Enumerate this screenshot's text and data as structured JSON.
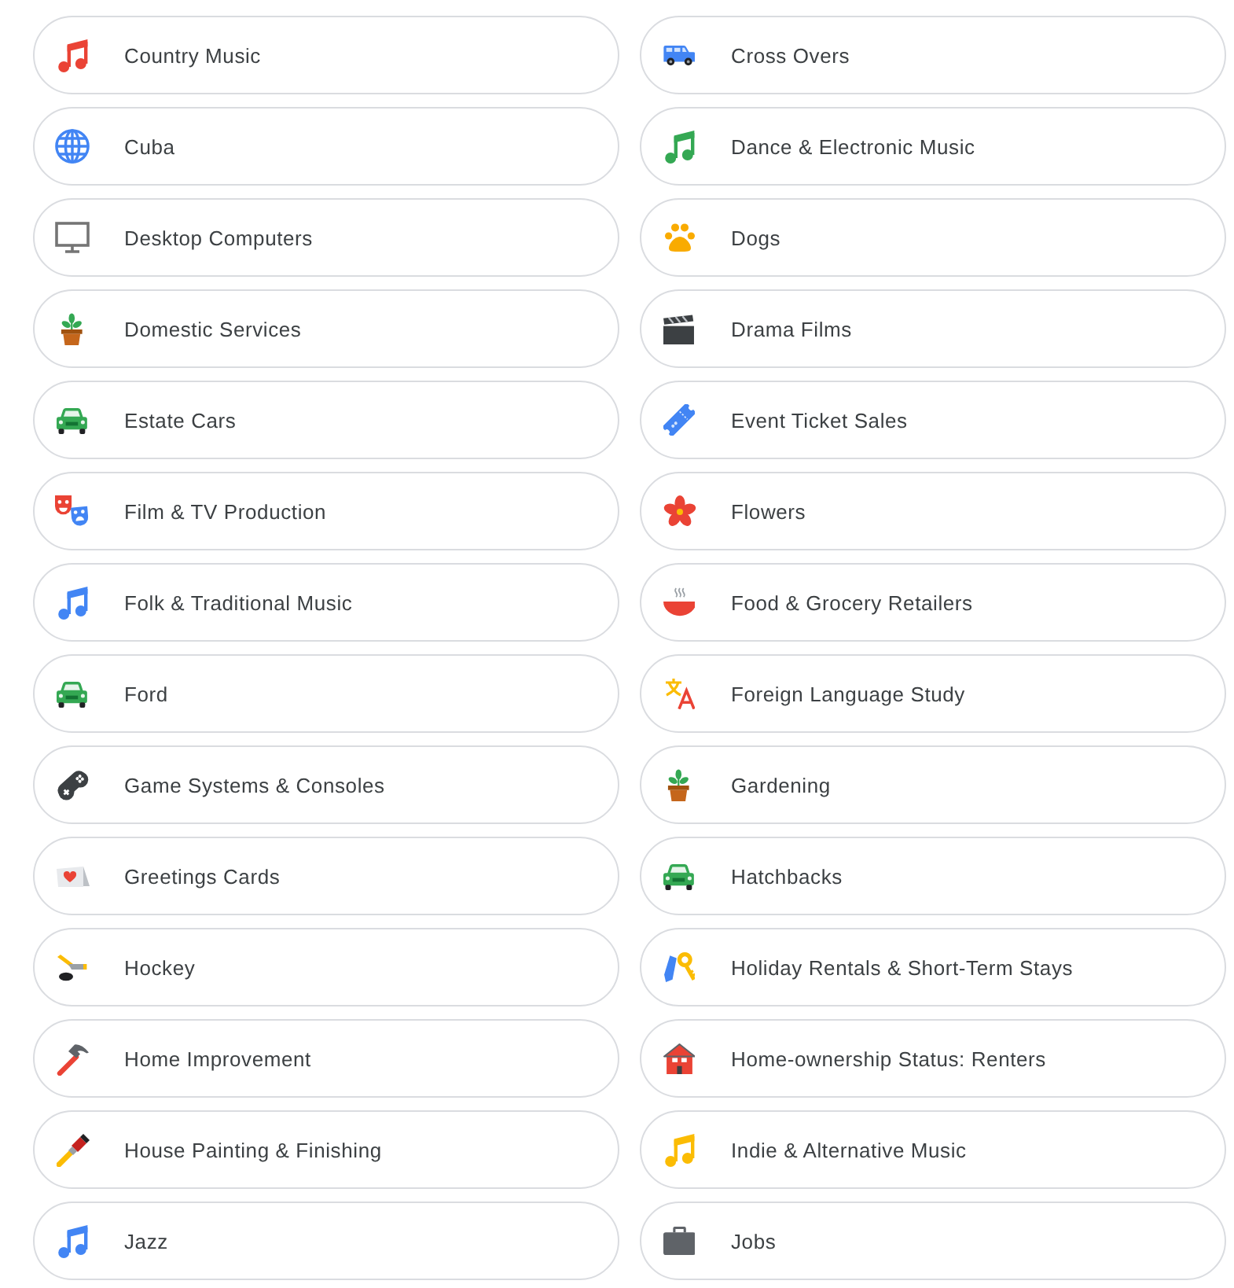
{
  "categories": [
    {
      "label": "Country Music",
      "kind": "music",
      "color": "#ea4335"
    },
    {
      "label": "Cross Overs",
      "kind": "van"
    },
    {
      "label": "Cuba",
      "kind": "globe"
    },
    {
      "label": "Dance & Electronic Music",
      "kind": "music",
      "color": "#34a853"
    },
    {
      "label": "Desktop Computers",
      "kind": "monitor"
    },
    {
      "label": "Dogs",
      "kind": "paw"
    },
    {
      "label": "Domestic Services",
      "kind": "plant"
    },
    {
      "label": "Drama Films",
      "kind": "clapperboard"
    },
    {
      "label": "Estate Cars",
      "kind": "car"
    },
    {
      "label": "Event Ticket Sales",
      "kind": "ticket"
    },
    {
      "label": "Film & TV Production",
      "kind": "masks"
    },
    {
      "label": "Flowers",
      "kind": "flower"
    },
    {
      "label": "Folk & Traditional Music",
      "kind": "music",
      "color": "#4285f4"
    },
    {
      "label": "Food & Grocery Retailers",
      "kind": "bowl"
    },
    {
      "label": "Ford",
      "kind": "car"
    },
    {
      "label": "Foreign Language Study",
      "kind": "translate"
    },
    {
      "label": "Game Systems & Consoles",
      "kind": "controller"
    },
    {
      "label": "Gardening",
      "kind": "plant"
    },
    {
      "label": "Greetings Cards",
      "kind": "card"
    },
    {
      "label": "Hatchbacks",
      "kind": "car"
    },
    {
      "label": "Hockey",
      "kind": "hockey"
    },
    {
      "label": "Holiday Rentals & Short-Term Stays",
      "kind": "keys"
    },
    {
      "label": "Home Improvement",
      "kind": "hammer"
    },
    {
      "label": "Home-ownership Status: Renters",
      "kind": "house"
    },
    {
      "label": "House Painting & Finishing",
      "kind": "brush"
    },
    {
      "label": "Indie & Alternative Music",
      "kind": "music",
      "color": "#fbbc04"
    },
    {
      "label": "Jazz",
      "kind": "music",
      "color": "#4285f4"
    },
    {
      "label": "Jobs",
      "kind": "briefcase"
    }
  ]
}
